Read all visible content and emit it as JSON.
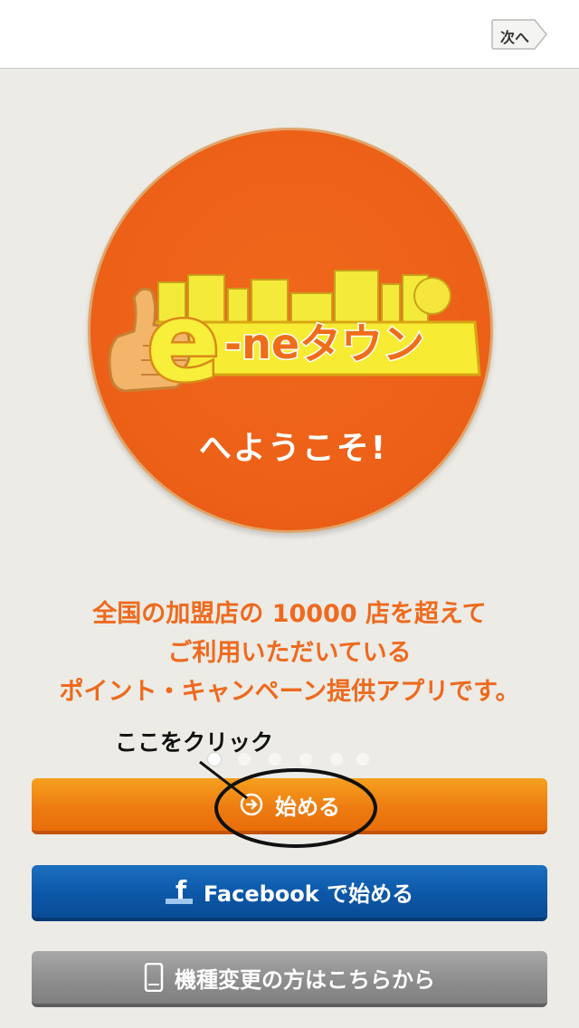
{
  "header": {
    "next_label": "次へ"
  },
  "hero": {
    "logo_text_main": "e",
    "logo_text_suffix": "-neタウン",
    "welcome": "へようこそ!"
  },
  "description": {
    "line1": "全国の加盟店の 10000 店を超えて",
    "line2": "ご利用いただいている",
    "line3": "ポイント・キャンペーン提供アプリです。"
  },
  "annotation": {
    "label": "ここをクリック"
  },
  "pager": {
    "count": 6,
    "active_index": 0
  },
  "buttons": {
    "start_label": "始める",
    "facebook_label": "Facebook で始める",
    "device_change_label": "機種変更の方はこちらから"
  },
  "colors": {
    "accent_orange": "#ee6a1e",
    "start_button": "#ee7d12",
    "facebook_button": "#0c57a8",
    "device_button": "#8e8e8e",
    "background": "#ecebe6"
  },
  "icons": {
    "next": "chevron-right-icon",
    "start": "arrow-right-circle-icon",
    "facebook": "facebook-icon",
    "device": "smartphone-icon"
  }
}
